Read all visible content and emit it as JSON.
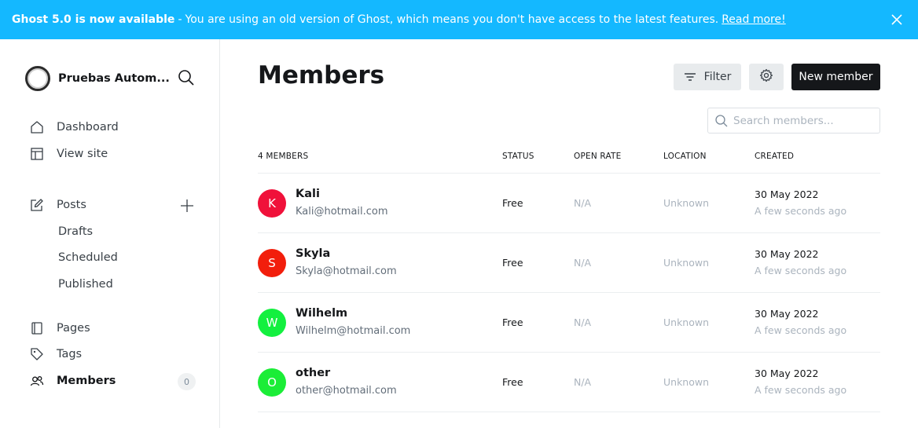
{
  "banner": {
    "title": "Ghost 5.0 is now available",
    "separator": "-",
    "message": "You are using an old version of Ghost, which means you don't have access to the latest features.",
    "link": "Read more!",
    "bg_color": "#14b8ff"
  },
  "sidebar": {
    "site_title": "Pruebas Autom...",
    "nav": [
      {
        "label": "Dashboard",
        "icon": "house-icon"
      },
      {
        "label": "View site",
        "icon": "layout-icon"
      },
      {
        "label": "Posts",
        "icon": "edit-icon"
      },
      {
        "label": "Pages",
        "icon": "page-icon"
      },
      {
        "label": "Tags",
        "icon": "tag-icon"
      },
      {
        "label": "Members",
        "icon": "members-icon",
        "active": true
      }
    ],
    "post_sub": [
      "Drafts",
      "Scheduled",
      "Published"
    ],
    "members_count": "0"
  },
  "main": {
    "title": "Members",
    "filter_label": "Filter",
    "new_member_label": "New member",
    "search_placeholder": "Search members...",
    "columns": [
      "4 MEMBERS",
      "STATUS",
      "OPEN RATE",
      "LOCATION",
      "CREATED"
    ],
    "members": [
      {
        "initial": "K",
        "name": "Kali",
        "email": "Kali@hotmail.com",
        "status": "Free",
        "open_rate": "N/A",
        "location": "Unknown",
        "created": "30 May 2022",
        "created_ago": "A few seconds ago",
        "color": "#f0113a"
      },
      {
        "initial": "S",
        "name": "Skyla",
        "email": "Skyla@hotmail.com",
        "status": "Free",
        "open_rate": "N/A",
        "location": "Unknown",
        "created": "30 May 2022",
        "created_ago": "A few seconds ago",
        "color": "#f21e0c"
      },
      {
        "initial": "W",
        "name": "Wilhelm",
        "email": "Wilhelm@hotmail.com",
        "status": "Free",
        "open_rate": "N/A",
        "location": "Unknown",
        "created": "30 May 2022",
        "created_ago": "A few seconds ago",
        "color": "#13f03f"
      },
      {
        "initial": "O",
        "name": "other",
        "email": "other@hotmail.com",
        "status": "Free",
        "open_rate": "N/A",
        "location": "Unknown",
        "created": "30 May 2022",
        "created_ago": "A few seconds ago",
        "color": "#1bed37"
      }
    ]
  }
}
